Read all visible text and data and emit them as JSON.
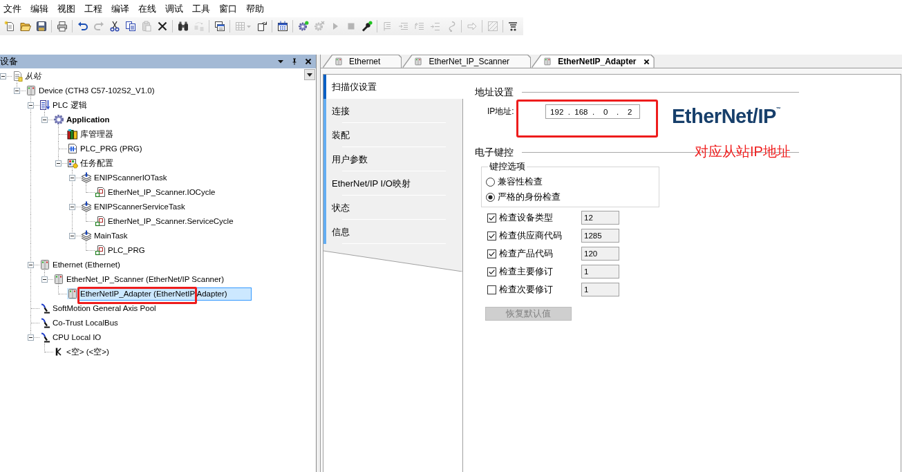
{
  "menu_bar": [
    "文件",
    "编辑",
    "视图",
    "工程",
    "编译",
    "在线",
    "调试",
    "工具",
    "窗口",
    "帮助"
  ],
  "toolbar": [
    [
      {
        "kind": "new",
        "disabled": false
      },
      {
        "kind": "open",
        "disabled": false
      },
      {
        "kind": "save",
        "disabled": false
      }
    ],
    [
      {
        "kind": "print",
        "disabled": false
      }
    ],
    [
      {
        "kind": "undo",
        "disabled": false
      },
      {
        "kind": "redo",
        "disabled": true
      },
      {
        "kind": "cut",
        "disabled": false
      },
      {
        "kind": "copy",
        "disabled": false
      },
      {
        "kind": "paste",
        "disabled": true
      },
      {
        "kind": "delete",
        "disabled": false
      }
    ],
    [
      {
        "kind": "find",
        "disabled": false
      },
      {
        "kind": "replace",
        "disabled": true
      }
    ],
    [
      {
        "kind": "windows",
        "disabled": false
      }
    ],
    [
      {
        "kind": "grid_menu",
        "disabled": true
      },
      {
        "kind": "document_arrow",
        "disabled": false
      }
    ],
    [
      {
        "kind": "calendar",
        "disabled": false
      }
    ],
    [
      {
        "kind": "login",
        "disabled": false
      },
      {
        "kind": "logout",
        "disabled": true
      },
      {
        "kind": "run",
        "disabled": true
      },
      {
        "kind": "stop",
        "disabled": true
      },
      {
        "kind": "wrench",
        "disabled": false
      }
    ],
    [
      {
        "kind": "step_over",
        "disabled": true
      },
      {
        "kind": "step_into",
        "disabled": true
      },
      {
        "kind": "step_out",
        "disabled": true
      },
      {
        "kind": "run_to_cursor",
        "disabled": true
      },
      {
        "kind": "set_next",
        "disabled": true
      }
    ],
    [
      {
        "kind": "arrow",
        "disabled": true
      }
    ],
    [
      {
        "kind": "hatch",
        "disabled": true
      }
    ],
    [
      {
        "kind": "cart",
        "disabled": false
      }
    ]
  ],
  "devices_panel": {
    "title": "设备",
    "tree": [
      {
        "label": "从站",
        "kind": "project",
        "expanded": true,
        "selected": false,
        "annotated": false,
        "children": [
          {
            "label": "Device (CTH3 C57-102S2_V1.0)",
            "kind": "device",
            "expanded": true,
            "selected": false,
            "annotated": false,
            "children": [
              {
                "label": "PLC 逻辑",
                "kind": "plc_logic",
                "expanded": true,
                "selected": false,
                "annotated": false,
                "children": [
                  {
                    "label": "Application",
                    "kind": "application",
                    "expanded": true,
                    "selected": false,
                    "annotated": false,
                    "children": [
                      {
                        "label": "库管理器",
                        "kind": "library",
                        "selected": false,
                        "annotated": false
                      },
                      {
                        "label": "PLC_PRG (PRG)",
                        "kind": "pou",
                        "selected": false,
                        "annotated": false
                      },
                      {
                        "label": "任务配置",
                        "kind": "task_config",
                        "expanded": true,
                        "selected": false,
                        "annotated": false,
                        "children": [
                          {
                            "label": "ENIPScannerIOTask",
                            "kind": "task",
                            "expanded": true,
                            "selected": false,
                            "annotated": false,
                            "children": [
                              {
                                "label": "EtherNet_IP_Scanner.IOCycle",
                                "kind": "program_call",
                                "selected": false,
                                "annotated": false
                              }
                            ]
                          },
                          {
                            "label": "ENIPScannerServiceTask",
                            "kind": "task",
                            "expanded": true,
                            "selected": false,
                            "annotated": false,
                            "children": [
                              {
                                "label": "EtherNet_IP_Scanner.ServiceCycle",
                                "kind": "program_call",
                                "selected": false,
                                "annotated": false
                              }
                            ]
                          },
                          {
                            "label": "MainTask",
                            "kind": "task",
                            "expanded": true,
                            "selected": false,
                            "annotated": false,
                            "children": [
                              {
                                "label": "PLC_PRG",
                                "kind": "program_call",
                                "selected": false,
                                "annotated": false
                              }
                            ]
                          }
                        ]
                      }
                    ]
                  }
                ]
              },
              {
                "label": "Ethernet (Ethernet)",
                "kind": "device",
                "expanded": true,
                "selected": false,
                "annotated": false,
                "children": [
                  {
                    "label": "EtherNet_IP_Scanner (EtherNet/IP Scanner)",
                    "kind": "device",
                    "expanded": true,
                    "selected": false,
                    "annotated": false,
                    "children": [
                      {
                        "label": "EtherNetIP_Adapter (EtherNetIP Adapter)",
                        "kind": "device",
                        "selected": true,
                        "annotated": true
                      }
                    ]
                  }
                ]
              },
              {
                "label": "SoftMotion General Axis Pool",
                "kind": "motion",
                "selected": false,
                "annotated": false
              },
              {
                "label": "Co-Trust LocalBus",
                "kind": "motion",
                "selected": false,
                "annotated": false
              },
              {
                "label": "CPU Local IO",
                "kind": "motion",
                "expanded": true,
                "selected": false,
                "annotated": false,
                "children": [
                  {
                    "label": "<空> (<空>)",
                    "kind": "empty_slot",
                    "selected": false,
                    "annotated": false
                  }
                ]
              }
            ]
          }
        ]
      }
    ]
  },
  "editor_tabs": [
    {
      "label": "Ethernet",
      "selected": false
    },
    {
      "label": "EtherNet_IP_Scanner",
      "selected": false
    },
    {
      "label": "EtherNetIP_Adapter",
      "selected": true
    }
  ],
  "editor": {
    "nav": [
      {
        "label": "扫描仪设置",
        "selected": true
      },
      {
        "label": "连接",
        "selected": false
      },
      {
        "label": "装配",
        "selected": false
      },
      {
        "label": "用户参数",
        "selected": false
      },
      {
        "label": "EtherNet/IP I/O映射",
        "selected": false
      },
      {
        "label": "状态",
        "selected": false
      },
      {
        "label": "信息",
        "selected": false
      }
    ],
    "address_section": {
      "title": "地址设置",
      "ip_label": "IP地址:",
      "ip_address": [
        "192",
        ".",
        "168",
        ".",
        "0",
        ".",
        "2"
      ],
      "annotated": true
    },
    "logo": "EtherNet/IP$^{™}$",
    "keying_section": {
      "title": "电子键控",
      "annotation_text": "对应从站IP地址",
      "options_group": {
        "title": "键控选项",
        "options": [
          {
            "label": "兼容性检查",
            "selected": false
          },
          {
            "label": "严格的身份检查",
            "selected": true
          }
        ]
      },
      "checks": [
        {
          "label": "检查设备类型",
          "checked": true,
          "value": "12"
        },
        {
          "label": "检查供应商代码",
          "checked": true,
          "value": "1285"
        },
        {
          "label": "检查产品代码",
          "checked": true,
          "value": "120"
        },
        {
          "label": "检查主要修订",
          "checked": true,
          "value": "1"
        },
        {
          "label": "检查次要修订",
          "checked": false,
          "value": "1"
        }
      ],
      "reset_button": {
        "label": "恢复默认值",
        "disabled": true
      }
    }
  }
}
